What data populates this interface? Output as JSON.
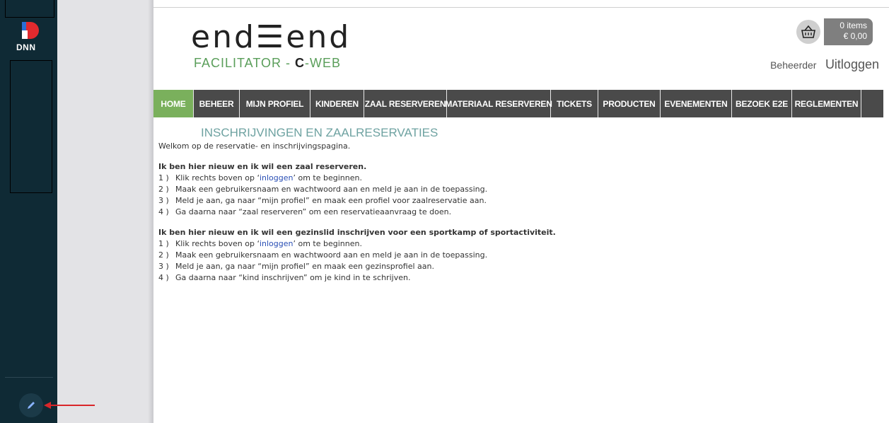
{
  "persona_bar": {
    "logo_text": "DNN"
  },
  "header": {
    "logo_main": "end☰end",
    "logo_sub_prefix": "FACILITATOR - ",
    "logo_sub_c": "C",
    "logo_sub_suffix": "-WEB"
  },
  "cart": {
    "items": "0 items",
    "total": "€ 0,00"
  },
  "user": {
    "name": "Beheerder",
    "logout": "Uitloggen"
  },
  "nav": {
    "items": [
      {
        "label": "HOME",
        "active": true
      },
      {
        "label": "BEHEER"
      },
      {
        "label": "MIJN PROFIEL"
      },
      {
        "label": "KINDEREN"
      },
      {
        "label": "ZAAL RESERVEREN"
      },
      {
        "label": "MATERIAAL RESERVEREN"
      },
      {
        "label": "TICKETS"
      },
      {
        "label": "PRODUCTEN"
      },
      {
        "label": "EVENEMENTEN"
      },
      {
        "label": "BEZOEK E2E"
      },
      {
        "label": "REGLEMENTEN"
      }
    ]
  },
  "content": {
    "title": "INSCHRIJVINGEN EN ZAALRESERVATIES",
    "intro": "Welkom op de reservatie- en inschrijvingspagina.",
    "section1": {
      "heading": "Ik ben hier nieuw en ik wil een zaal reserveren.",
      "steps": [
        {
          "num": "1 )",
          "pre": "Klik rechts boven op ‘",
          "link": "inloggen",
          "post": "’ om te beginnen."
        },
        {
          "num": "2 )",
          "text": "Maak een gebruikersnaam en wachtwoord aan en meld je aan in de toepassing."
        },
        {
          "num": "3 )",
          "text": "Meld je aan, ga naar “mijn profiel” en maak een profiel voor zaalreservatie aan."
        },
        {
          "num": "4 )",
          "text": "Ga daarna naar “zaal reserveren” om een reservatieaanvraag te doen."
        }
      ]
    },
    "section2": {
      "heading": "Ik ben hier nieuw en ik wil een gezinslid inschrijven voor een sportkamp of sportactiviteit.",
      "steps": [
        {
          "num": "1 )",
          "pre": "Klik rechts boven op ‘",
          "link": "inloggen",
          "post": "’ om te beginnen."
        },
        {
          "num": "2 )",
          "text": "Maak een gebruikersnaam en wachtwoord aan en meld je aan in de toepassing."
        },
        {
          "num": "3 )",
          "text": "Meld je aan, ga naar “mijn profiel” en maak een gezinsprofiel aan."
        },
        {
          "num": "4 )",
          "text": "Ga daarna naar “kind inschrijven” om je kind in te schrijven."
        }
      ]
    }
  },
  "colors": {
    "nav_active": "#7ab05c",
    "nav_bg": "#4a4a4a",
    "title": "#6ea2a1",
    "persona_bar": "#0f2a35",
    "annotation_arrow": "#d9262a"
  }
}
